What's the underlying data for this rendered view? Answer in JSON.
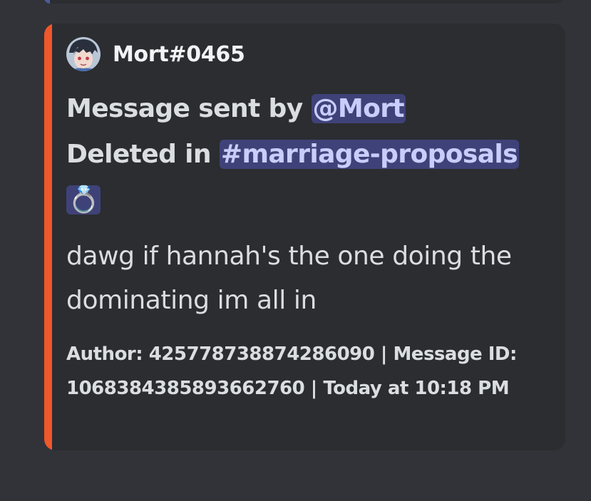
{
  "embed": {
    "accent_color": "#f0572a",
    "author": {
      "avatar_icon": "user-avatar-icon",
      "name": "Mort#0465"
    },
    "title": {
      "prefix": "Message sent by ",
      "mention": "@Mort",
      "deleted_prefix": "Deleted in ",
      "channel": "#marriage-proposals",
      "channel_emoji": "💍"
    },
    "description": "dawg if hannah's the one doing the dominating im all in",
    "footer": "Author: 425778738874286090 | Message ID: 1068384385893662760 | Today at 10:18 PM"
  }
}
